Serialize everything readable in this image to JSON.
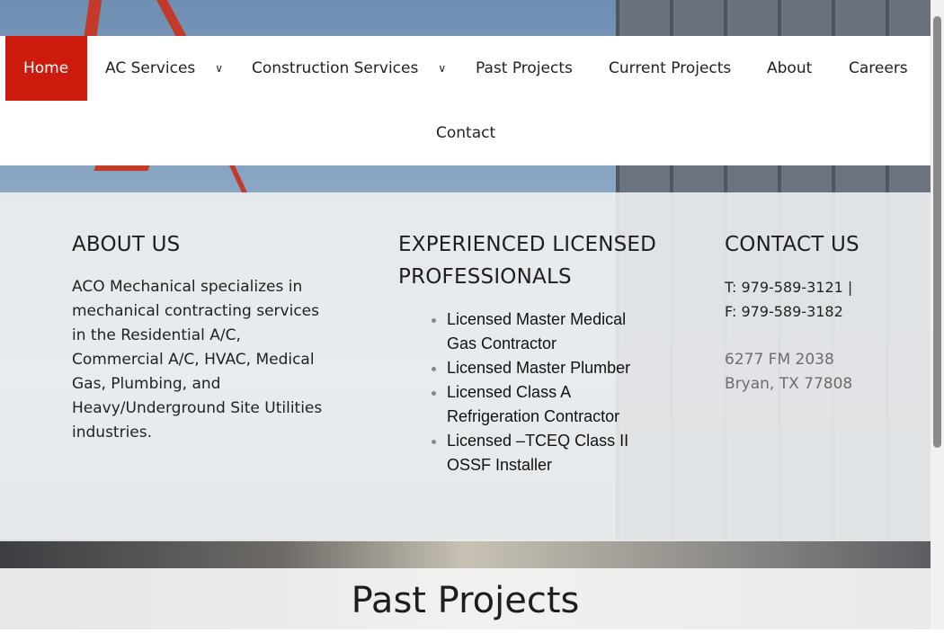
{
  "nav": {
    "items": [
      {
        "label": "Home",
        "active": true
      },
      {
        "label": "AC Services",
        "has_dropdown": true
      },
      {
        "label": "Construction Services",
        "has_dropdown": true
      },
      {
        "label": "Past Projects"
      },
      {
        "label": "Current Projects"
      },
      {
        "label": "About"
      },
      {
        "label": "Careers"
      },
      {
        "label": "Contact"
      }
    ]
  },
  "about": {
    "heading": "ABOUT US",
    "text": "ACO Mechanical specializes in mechanical contracting services in the Residential A/C, Commercial A/C, HVAC, Medical Gas, Plumbing, and Heavy/Underground Site Utilities industries."
  },
  "professionals": {
    "heading": "EXPERIENCED LICENSED PROFESSIONALS",
    "items": [
      "Licensed Master Medical Gas Contractor",
      "Licensed Master Plumber",
      "Licensed Class A Refrigeration Contractor",
      "Licensed –TCEQ Class II OSSF Installer"
    ]
  },
  "contact": {
    "heading": "CONTACT US",
    "phone": "T: 979-589-3121 |",
    "fax": "F: 979-589-3182",
    "address_line1": "6277 FM 2038",
    "address_line2": "Bryan, TX 77808"
  },
  "past_projects": {
    "heading": "Past Projects"
  },
  "colors": {
    "accent": "#cc1b0d"
  }
}
